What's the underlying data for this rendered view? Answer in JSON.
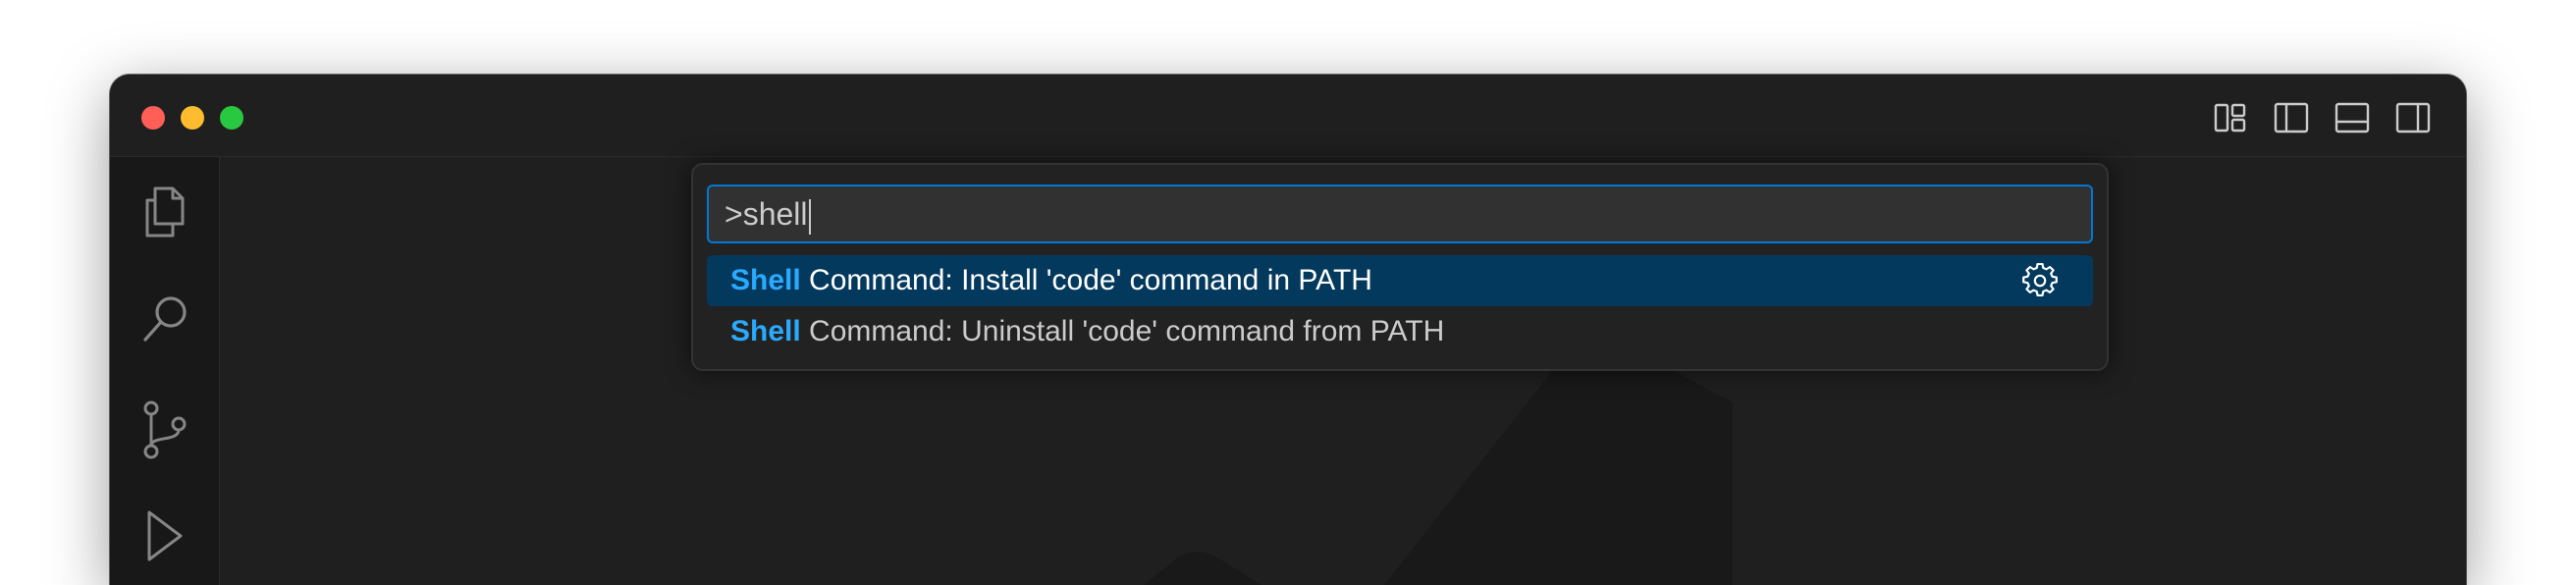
{
  "command_palette": {
    "input_value": ">shell",
    "results": [
      {
        "highlight": "Shell",
        "rest": " Command: Install 'code' command in PATH",
        "selected": true,
        "action_icon": "gear-icon"
      },
      {
        "highlight": "Shell",
        "rest": " Command: Uninstall 'code' command from PATH",
        "selected": false
      }
    ]
  },
  "titlebar": {
    "traffic_lights": [
      "close",
      "minimize",
      "maximize"
    ],
    "layout_controls": [
      "customize-layout-icon",
      "toggle-primary-sidebar-icon",
      "toggle-panel-icon",
      "toggle-secondary-sidebar-icon"
    ]
  },
  "activity_bar": {
    "items": [
      "explorer-icon",
      "search-icon",
      "source-control-icon",
      "run-debug-icon"
    ]
  },
  "colors": {
    "accent": "#0078d4",
    "match_highlight": "#2aaaff",
    "selection": "#04395e",
    "background": "#1f1f1f"
  }
}
